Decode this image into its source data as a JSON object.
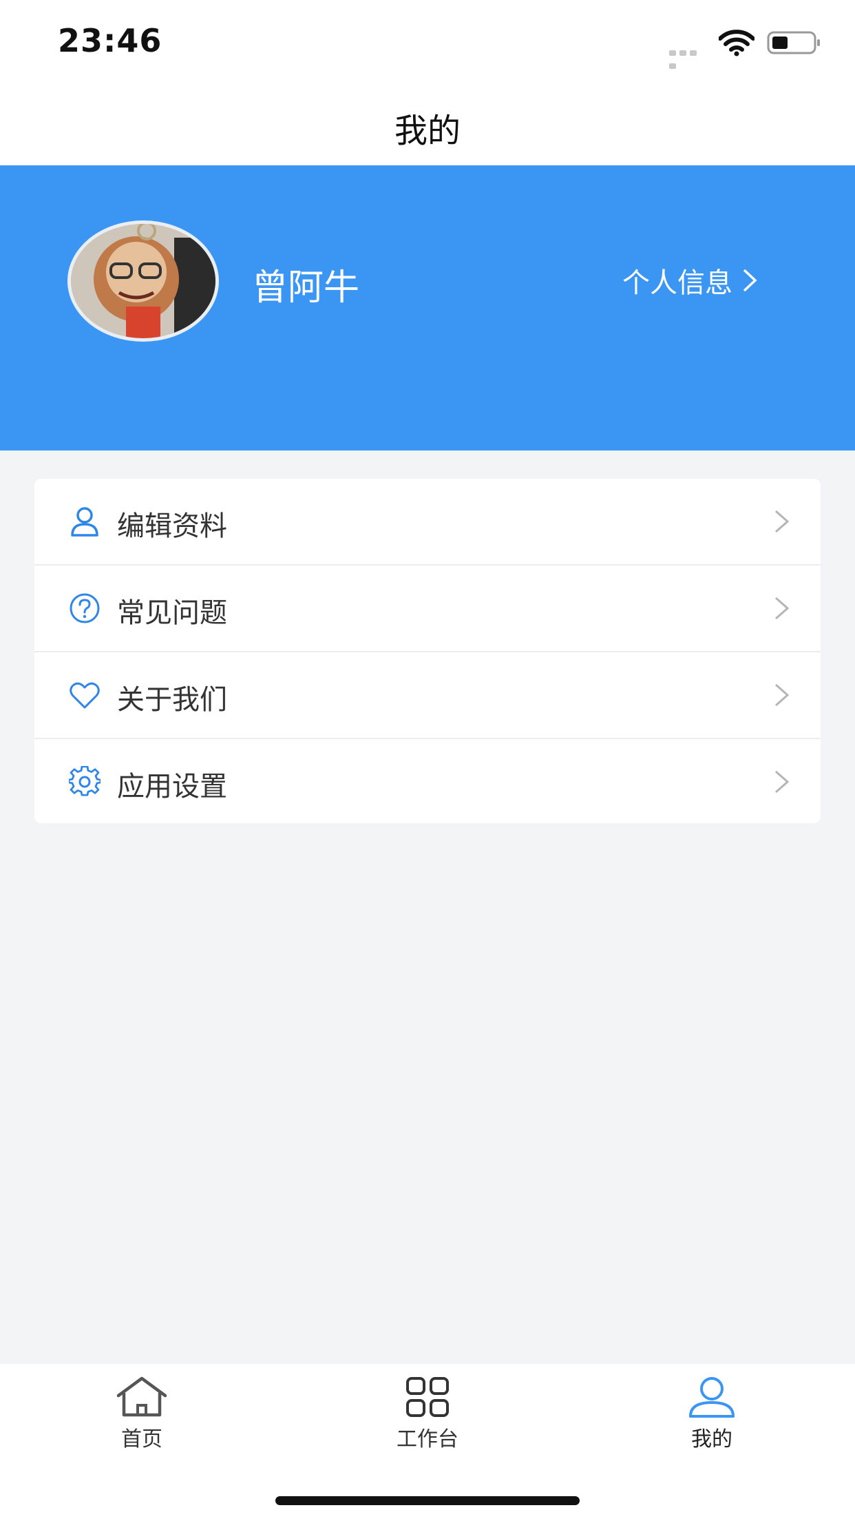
{
  "status_bar": {
    "time": "23:46"
  },
  "nav": {
    "title": "我的"
  },
  "profile": {
    "name": "曾阿牛",
    "info_link": "个人信息"
  },
  "menu": {
    "items": [
      {
        "label": "编辑资料",
        "icon": "user-icon"
      },
      {
        "label": "常见问题",
        "icon": "question-circle-icon"
      },
      {
        "label": "关于我们",
        "icon": "heart-icon"
      },
      {
        "label": "应用设置",
        "icon": "gear-icon"
      }
    ]
  },
  "tabbar": {
    "tabs": [
      {
        "label": "首页",
        "icon": "home-icon"
      },
      {
        "label": "工作台",
        "icon": "grid-icon"
      },
      {
        "label": "我的",
        "icon": "person-icon",
        "active": true
      }
    ]
  },
  "colors": {
    "accent": "#3b95f3",
    "icon_blue": "#2e86e8",
    "background": "#f3f4f6"
  }
}
